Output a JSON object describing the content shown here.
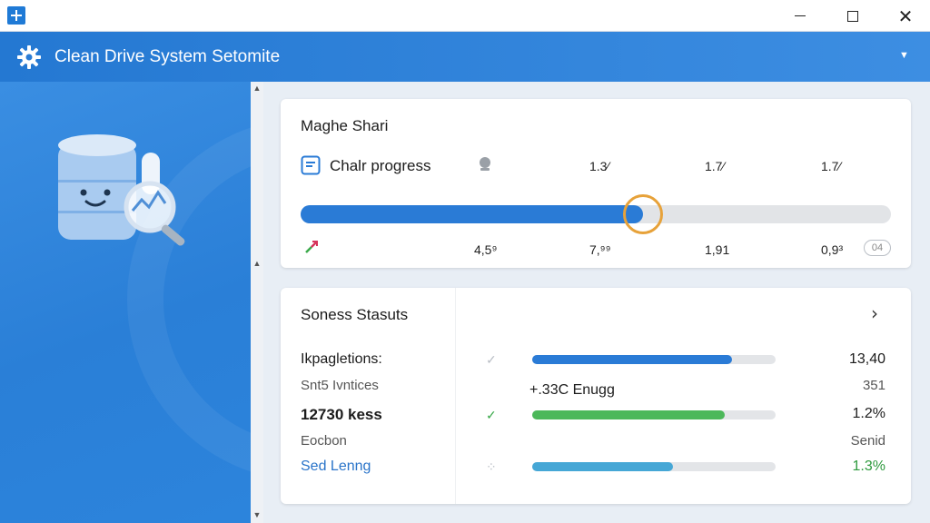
{
  "header": {
    "title": "Clean Drive System Setomite"
  },
  "progress_card": {
    "title": "Maghe Shari",
    "progress_label": "Chalr progress",
    "top_values": [
      "1.3⁄",
      "1.7⁄",
      "1.7⁄"
    ],
    "bottom_values": [
      "4,5⁹",
      "7,⁹⁹",
      "1,91",
      "0,9³"
    ],
    "badge": "04",
    "progress": 0.58,
    "colors": {
      "fill": "#2a7bd6",
      "knob": "#e7a23a"
    }
  },
  "status_card": {
    "title": "Soness Stasuts",
    "rows": [
      {
        "label": "Ikpagletions:",
        "value": "13,40",
        "bar": 0.82,
        "bar_color": "#2a7bd6",
        "check": "✓",
        "check_color": "#b9bec5"
      },
      {
        "label": "Snt5 Ivntices",
        "value": "351",
        "mid_label": "+.33C Enugg"
      },
      {
        "label": "12730 kess",
        "value": "1.2%",
        "bar": 0.79,
        "bar_color": "#4cb85a",
        "check": "✓",
        "check_color": "#3aa94a"
      },
      {
        "label": "Eocbon",
        "value": "Senid"
      },
      {
        "label": "Sed Lenng",
        "value": "1.3%",
        "bar": 0.58,
        "bar_color": "#46a7d6",
        "check": "⁘",
        "check_color": "#b9bec5"
      }
    ]
  }
}
